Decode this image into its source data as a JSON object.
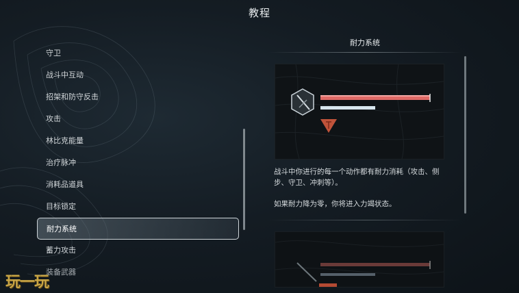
{
  "header": {
    "title": "教程"
  },
  "menu": {
    "items": [
      {
        "label": "守卫"
      },
      {
        "label": "战斗中互动"
      },
      {
        "label": "招架和防守反击"
      },
      {
        "label": "攻击"
      },
      {
        "label": "林比克能量"
      },
      {
        "label": "治疗脉冲"
      },
      {
        "label": "消耗品道具"
      },
      {
        "label": "目标锁定"
      },
      {
        "label": "耐力系统",
        "selected": true
      },
      {
        "label": "蓄力攻击"
      },
      {
        "label": "装备武器"
      }
    ]
  },
  "panel": {
    "title": "耐力系统",
    "description_1": "战斗中你进行的每一个动作都有耐力消耗（攻击、侧步、守卫、冲刺等）。",
    "description_2": "如果耐力降为零，你将进入力竭状态。"
  },
  "watermark": {
    "text": "玩一玩"
  },
  "colors": {
    "health": "#e06a66",
    "stamina": "#d8e6ee",
    "warning": "#c0533a"
  }
}
